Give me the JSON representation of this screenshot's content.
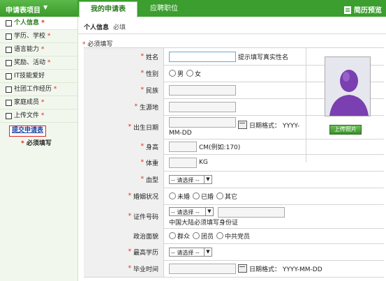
{
  "topbar": {
    "menu_title": "申请表项目",
    "tabs": [
      "我的申请表",
      "应聘职位"
    ],
    "preview": "简历预览"
  },
  "sidebar": {
    "items": [
      {
        "label": "个人信息",
        "required": "*",
        "active": true
      },
      {
        "label": "学历、学校",
        "required": "*"
      },
      {
        "label": "语言能力",
        "required": "*"
      },
      {
        "label": "奖励、活动",
        "required": "*"
      },
      {
        "label": "IT技能爱好",
        "required": ""
      },
      {
        "label": "社团工作经历",
        "required": "*"
      },
      {
        "label": "家庭成员",
        "required": "*"
      },
      {
        "label": "上传文件",
        "required": "*"
      }
    ],
    "submit": "提交申请表",
    "required_note": "必须填写"
  },
  "main": {
    "section_title": "个人信息",
    "section_sub": "必填",
    "required_head": "必须填写",
    "photo_button": "上传照片",
    "rows": {
      "name": {
        "label": "姓名",
        "hint": "提示填写真实性名"
      },
      "gender": {
        "label": "性别",
        "opt1": "男",
        "opt2": "女"
      },
      "ethnicity": {
        "label": "民族"
      },
      "origin": {
        "label": "生源地"
      },
      "birth": {
        "label": "出生日期",
        "hint": "日期格式：  YYYY-",
        "hint2": "MM-DD"
      },
      "height": {
        "label": "身高",
        "unit": "CM(例如:170)"
      },
      "weight": {
        "label": "体重",
        "unit": "KG"
      },
      "blood": {
        "label": "血型",
        "select": "-- 请选择 --"
      },
      "marital": {
        "label": "婚姻状况",
        "opt1": "未婚",
        "opt2": "已婚",
        "opt3": "其它"
      },
      "idno": {
        "label": "证件号码",
        "select": "-- 请选择 --",
        "note": "中国大陆必须填写身份证"
      },
      "political": {
        "label": "政治面貌",
        "opt1": "群众",
        "opt2": "团员",
        "opt3": "中共党员"
      },
      "education": {
        "label": "最高学历",
        "select": "-- 请选择 --"
      },
      "graduation": {
        "label": "毕业时间",
        "hint": "日期格式：  YYYY-MM-DD"
      }
    }
  },
  "colors": {
    "brand_green": "#3b9e2e",
    "required_red": "#e0231a"
  }
}
